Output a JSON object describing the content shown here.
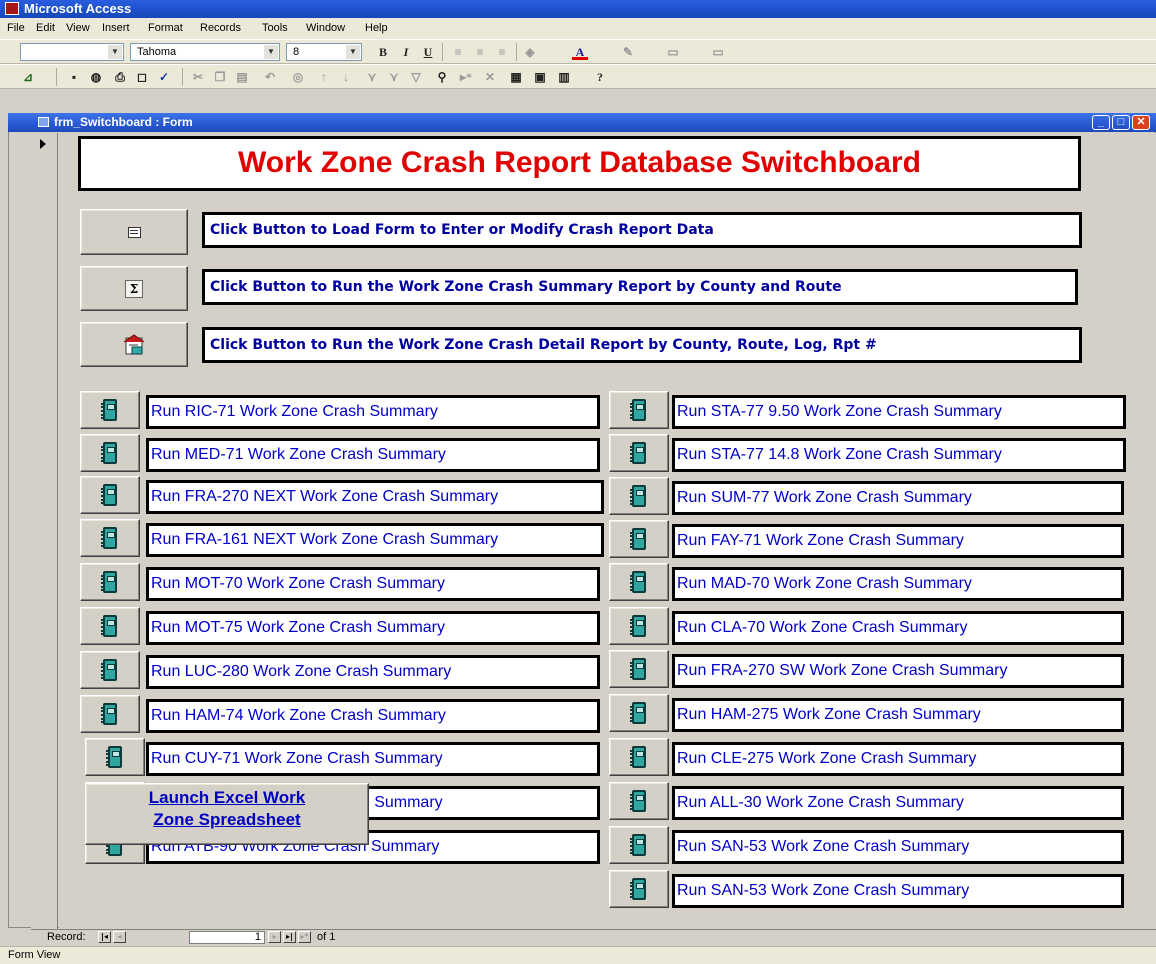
{
  "app": {
    "title": "Microsoft Access"
  },
  "menu": [
    "File",
    "Edit",
    "View",
    "Insert",
    "Format",
    "Records",
    "Tools",
    "Window",
    "Help"
  ],
  "format_toolbar": {
    "object_combo": "",
    "font": "Tahoma",
    "size": "8"
  },
  "form": {
    "window_title": "frm_Switchboard : Form",
    "header": "Work Zone Crash Report Database Switchboard",
    "instructions": [
      {
        "text": "Click Button to Load Form to Enter or Modify Crash Report Data",
        "icon": "form-icon"
      },
      {
        "text": "Click Button to Run the Work Zone Crash Summary Report by County and Route",
        "icon": "sum-icon"
      },
      {
        "text": "Click Button to Run the Work Zone Crash Detail Report by County, Route, Log, Rpt #",
        "icon": "report-detail-icon"
      }
    ],
    "left_reports": [
      "Run RIC-71 Work Zone Crash Summary",
      "Run MED-71 Work Zone Crash Summary",
      "Run FRA-270 NEXT Work Zone Crash Summary",
      "Run FRA-161 NEXT Work Zone Crash Summary",
      "Run MOT-70 Work Zone Crash Summary",
      "Run MOT-75 Work Zone Crash Summary",
      "Run LUC-280 Work Zone Crash Summary",
      "Run HAM-74 Work Zone Crash Summary",
      "Run CUY-71 Work Zone Crash Summary",
      "Run CUY-90 Work Zone Crash Summary",
      "Run ATB-90 Work Zone Crash Summary"
    ],
    "right_reports": [
      "Run STA-77 9.50 Work Zone Crash Summary",
      "Run STA-77 14.8 Work Zone Crash Summary",
      "Run SUM-77 Work Zone Crash Summary",
      "Run FAY-71 Work Zone Crash Summary",
      "Run MAD-70 Work Zone Crash Summary",
      "Run CLA-70 Work Zone Crash Summary",
      "Run FRA-270 SW Work Zone Crash Summary",
      "Run HAM-275 Work Zone Crash Summary",
      "Run CLE-275 Work Zone Crash Summary",
      "Run ALL-30 Work Zone Crash Summary",
      "Run SAN-53 Work Zone Crash Summary",
      "Run SAN-53 Work Zone Crash Summary"
    ],
    "excel_button": {
      "line1": "Launch Excel Work",
      "line2": "Zone Spreadsheet"
    }
  },
  "record_nav": {
    "label": "Record:",
    "current": "1",
    "of_text": "of 1"
  },
  "status": {
    "text": "Form View"
  },
  "colors": {
    "header_text": "#e00000",
    "label_text": "#0000c8",
    "title_bar": "#2a5ee0",
    "report_icon": "#2fa7a0"
  }
}
